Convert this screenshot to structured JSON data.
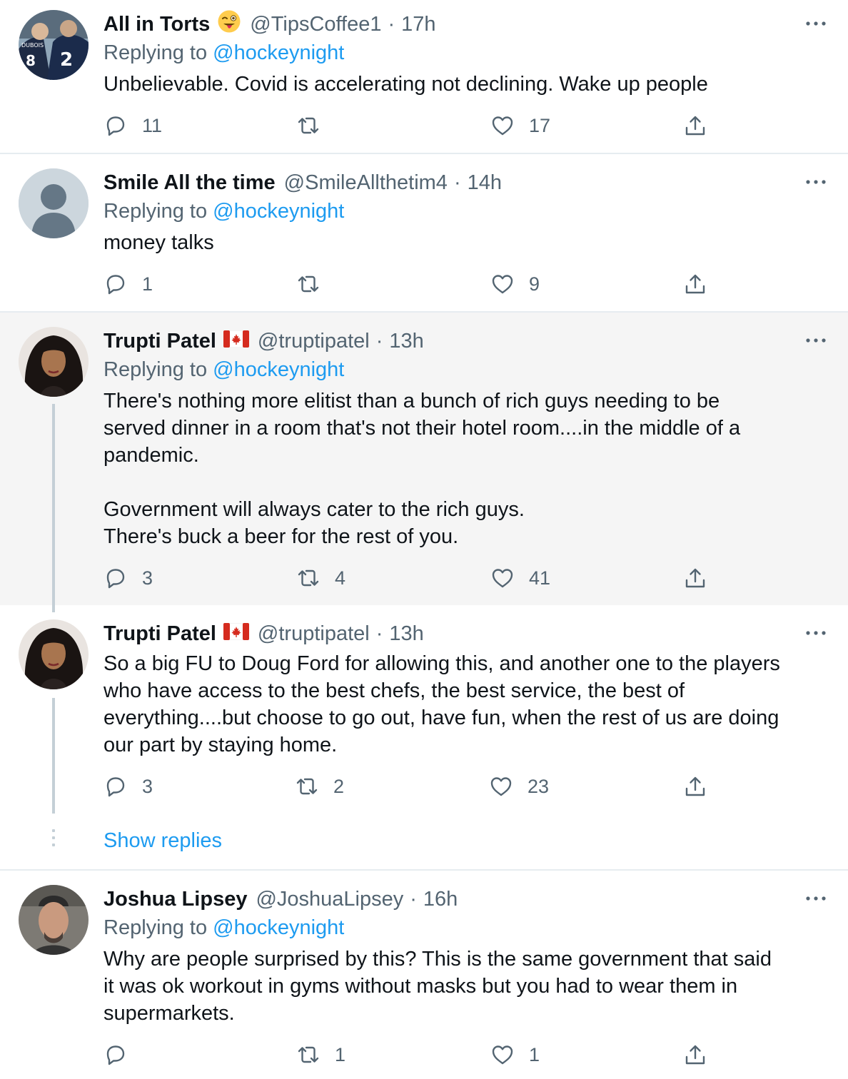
{
  "tweets": [
    {
      "name": "All in Torts",
      "emoji": "😜",
      "handle": "@TipsCoffee1",
      "time": "17h",
      "replying_label": "Replying to",
      "replying_to": "@hockeynight",
      "text": "Unbelievable. Covid is accelerating not declining. Wake up people",
      "replies": "11",
      "retweets": "",
      "likes": "17"
    },
    {
      "name": "Smile All the time",
      "handle": "@SmileAllthetim4",
      "time": "14h",
      "replying_label": "Replying to",
      "replying_to": "@hockeynight",
      "text": "money talks",
      "replies": "1",
      "retweets": "",
      "likes": "9"
    },
    {
      "name": "Trupti Patel",
      "flag": "canada-flag",
      "handle": "@truptipatel",
      "time": "13h",
      "replying_label": "Replying to",
      "replying_to": "@hockeynight",
      "text": "There's nothing more elitist than a bunch of rich guys needing to be\nserved dinner in a room that's not their hotel room....in the middle of a\npandemic.\n\nGovernment will always cater to the rich guys.\nThere's buck a beer for the rest of you.",
      "replies": "3",
      "retweets": "4",
      "likes": "41"
    },
    {
      "name": "Trupti Patel",
      "flag": "canada-flag",
      "handle": "@truptipatel",
      "time": "13h",
      "text": "So a big FU to Doug Ford for allowing this, and another one to the players\nwho have access to the best chefs, the best service, the best of\neverything....but choose to go out, have fun, when the rest of us are doing\nour part by staying home.",
      "replies": "3",
      "retweets": "2",
      "likes": "23"
    },
    {
      "name": "Joshua Lipsey",
      "handle": "@JoshuaLipsey",
      "time": "16h",
      "replying_label": "Replying to",
      "replying_to": "@hockeynight",
      "text": "Why are people surprised by this? This is the same government that said\nit was ok workout in gyms without masks but you had to wear them in\nsupermarkets.",
      "replies": "",
      "retweets": "1",
      "likes": "1"
    }
  ],
  "show_replies": "Show replies",
  "separator": "·",
  "colors": {
    "link": "#1d9bf0",
    "muted": "#536471",
    "text": "#0f1419",
    "highlight_bg": "#f5f5f5"
  }
}
